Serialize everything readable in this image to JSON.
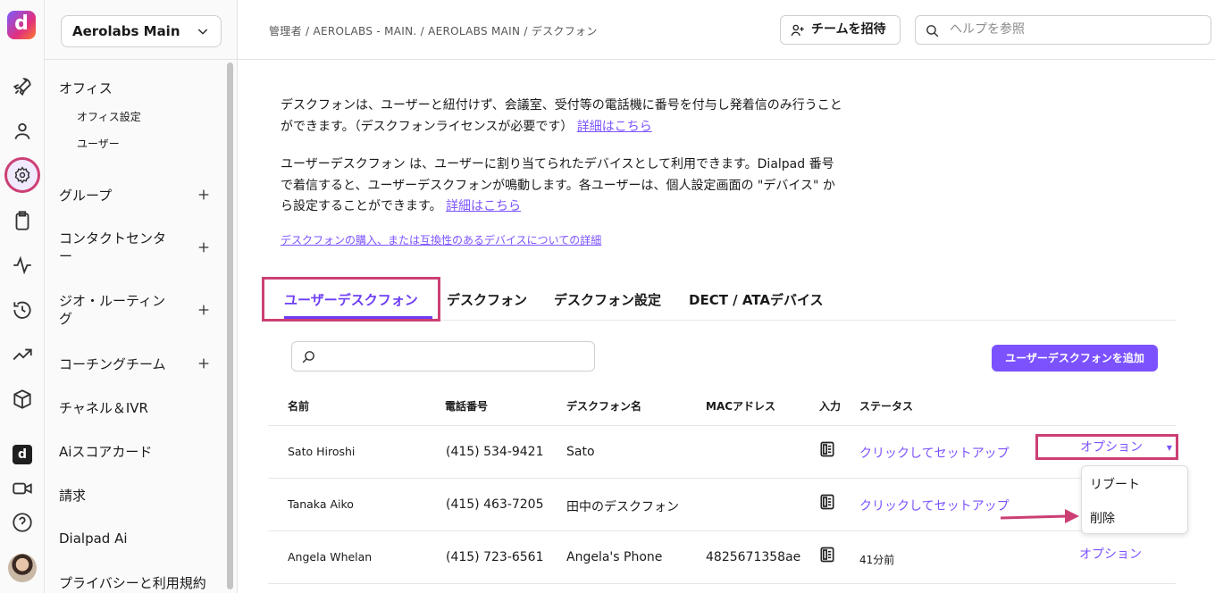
{
  "colors": {
    "accent": "#7c52ff",
    "highlight": "#cc3f74"
  },
  "sidebar": {
    "workspace": "Aerolabs Main",
    "items": [
      {
        "label": "オフィス"
      },
      {
        "label": "オフィス設定"
      },
      {
        "label": "ユーザー"
      },
      {
        "label": "グループ"
      },
      {
        "label": "コンタクトセンター"
      },
      {
        "label": "ジオ・ルーティング"
      },
      {
        "label": "コーチングチーム"
      },
      {
        "label": "チャネル＆IVR"
      },
      {
        "label": "Aiスコアカード"
      },
      {
        "label": "請求"
      },
      {
        "label": "Dialpad Ai"
      },
      {
        "label": "プライバシーと利用規約"
      }
    ]
  },
  "header": {
    "breadcrumb": "管理者 / AEROLABS - MAIN. / AEROLABS MAIN / デスクフォン",
    "invite_label": "チームを招待",
    "help_placeholder": "ヘルプを参照"
  },
  "intro": {
    "p1": "デスクフォンは、ユーザーと紐付けず、会議室、受付等の電話機に番号を付与し発着信のみ行うことができます。（デスクフォンライセンスが必要です）",
    "p1_link": "詳細はこちら",
    "p2": "ユーザーデスクフォン は、ユーザーに割り当てられたデバイスとして利用できます。Dialpad 番号で着信すると、ユーザーデスクフォンが鳴動します。各ユーザーは、個人設定画面の \"デバイス\" から設定することができます。",
    "p2_link": "詳細はこちら",
    "buy_link": "デスクフォンの購入、または互換性のあるデバイスについての詳細"
  },
  "tabs": [
    "ユーザーデスクフォン",
    "デスクフォン",
    "デスクフォン設定",
    "DECT / ATAデバイス"
  ],
  "add_button": "ユーザーデスクフォンを追加",
  "table": {
    "headers": [
      "名前",
      "電話番号",
      "デスクフォン名",
      "MACアドレス",
      "入力",
      "ステータス"
    ],
    "rows": [
      {
        "name": "Sato Hiroshi",
        "phone": "(415) 534-9421",
        "desk_name": "Sato",
        "mac": "",
        "status": "クリックしてセットアップ",
        "option": "オプション"
      },
      {
        "name": "Tanaka Aiko",
        "phone": "(415) 463-7205",
        "desk_name": "田中のデスクフォン",
        "mac": "",
        "status": "クリックしてセットアップ",
        "option": ""
      },
      {
        "name": "Angela Whelan",
        "phone": "(415) 723-6561",
        "desk_name": "Angela's Phone",
        "mac": "4825671358ae",
        "status": "41分前",
        "option": "オプション"
      }
    ]
  },
  "options_menu": [
    "リブート",
    "削除"
  ]
}
